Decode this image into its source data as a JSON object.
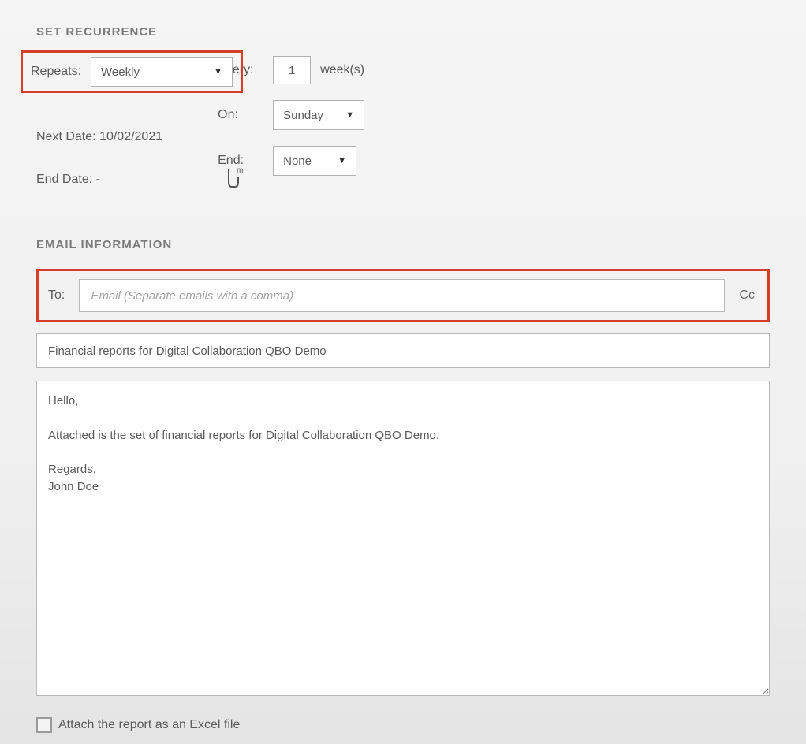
{
  "recurrence": {
    "header": "SET RECURRENCE",
    "repeats_label": "Repeats:",
    "repeats_value": "Weekly",
    "every_label": "Every:",
    "every_value": "1",
    "every_units": "week(s)",
    "on_label": "On:",
    "on_value": "Sunday",
    "end_label": "End:",
    "end_value": "None",
    "next_date_label": "Next Date:",
    "next_date_value": "10/02/2021",
    "end_date_label": "End Date:",
    "end_date_value": "-"
  },
  "email": {
    "header": "EMAIL INFORMATION",
    "to_label": "To:",
    "to_placeholder": "Email (Separate emails with a comma)",
    "cc_label": "Cc",
    "subject_value": "Financial reports for Digital Collaboration QBO Demo",
    "body_value": "Hello,\n\nAttached is the set of financial reports for Digital Collaboration QBO Demo.\n\nRegards,\nJohn Doe",
    "attach_label": "Attach the report as an Excel file"
  }
}
